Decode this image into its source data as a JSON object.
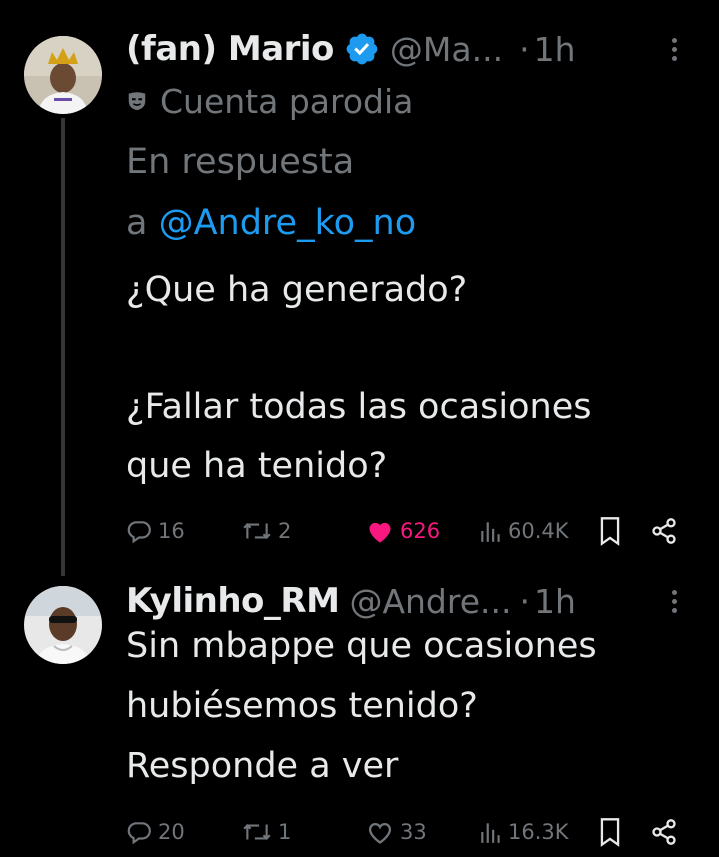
{
  "tweets": [
    {
      "display_name": "(fan) Mario",
      "handle": "@Ma...",
      "separator": "·",
      "time": "1h",
      "parody_label": "Cuenta parodia",
      "reply_prefix": "En respuesta",
      "reply_a": "a",
      "reply_mention": "@Andre_ko_no",
      "text_lines": [
        "¿Que ha generado?",
        "¿Fallar todas las ocasiones",
        "que ha tenido?"
      ],
      "stats": {
        "replies": "16",
        "retweets": "2",
        "likes": "626",
        "views": "60.4K"
      }
    },
    {
      "display_name": "Kylinho_RM",
      "handle": "@Andre...",
      "separator": "·",
      "time": "1h",
      "text_lines": [
        "Sin mbappe que ocasiones",
        "hubiésemos tenido?",
        "Responde a ver"
      ],
      "stats": {
        "replies": "20",
        "retweets": "1",
        "likes": "33",
        "views": "16.3K"
      }
    }
  ],
  "colors": {
    "background": "#000000",
    "text": "#e7e9ea",
    "muted": "#71767b",
    "link": "#1d9bf0",
    "like": "#f91880",
    "verified": "#1d9bf0"
  }
}
